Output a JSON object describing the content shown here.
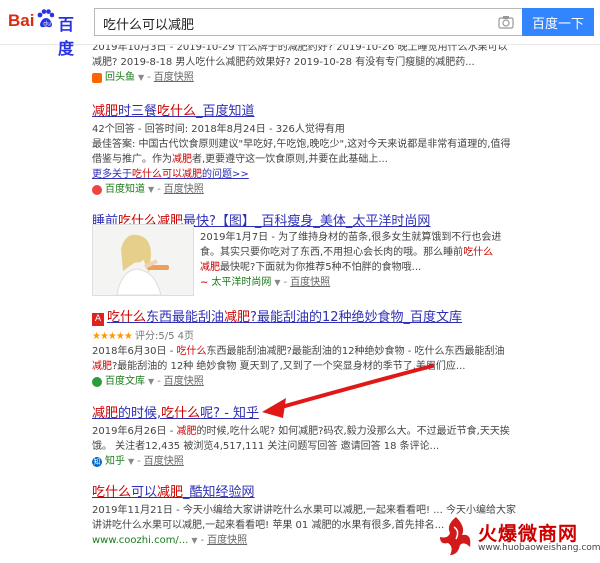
{
  "header": {
    "logo_bai": "Bai",
    "logo_du": "百度",
    "query": "吃什么可以减肥",
    "search_button": "百度一下",
    "camera_icon": "camera-icon"
  },
  "r0": {
    "line1": "2019年10月3日 - 2019-10-29 什么牌子的减肥药好? 2019-10-26 晚上睡觉用什么水果可以",
    "line2": "减肥? 2019-8-18 男人吃什么减肥药效果好? 2019-10-28 有没有专门瘦腿的减肥药...",
    "source": "回头鱼",
    "kuaizhao": "百度快照"
  },
  "r1": {
    "title_a": "减肥",
    "title_b": "时三餐",
    "title_c": "吃什么",
    "title_d": "_百度知道",
    "meta": "42个回答 - 回答时间: 2018年8月24日 - 326人觉得有用",
    "ans_pre": "最佳答案: 中国古代饮食原则建议\"早吃好,午吃饱,晚吃少\",这对今天来说都是非常有道理的,值得",
    "ans2_pre": "借鉴与推广。作为",
    "ans2_em": "减肥",
    "ans2_post": "者,更要遵守这一饮食原则,并要在此基础上...",
    "more_pre": "更多关于",
    "more_em": "吃什么可以减肥",
    "more_post": "的问题>>",
    "source": "百度知道",
    "kuaizhao": "百度快照"
  },
  "r2": {
    "title_a": "睡前",
    "title_b": "吃什么减肥",
    "title_c": "最快?【图】_百科瘦身_美体_太平洋时尚网",
    "l1": "2019年1月7日 - 为了维持身材的苗条,很多女生就算饿到不行也会进",
    "l2": "食。其实只要你吃对了东西,不用担心会长肉的哦。那么睡前",
    "l2_em": "吃什么",
    "l3_em": "减肥",
    "l3": "最快呢?下面就为你推荐5种不怕胖的食物哦...",
    "source": "太平洋时尚网",
    "kuaizhao": "百度快照"
  },
  "r3": {
    "title_a": "吃什么",
    "title_b": "东西最能刮油",
    "title_c": "减肥",
    "title_d": "?最能刮油的12种绝妙食物_百度文库",
    "stars": "★★★★★",
    "rating": "评分:5/5 4页",
    "l1_pre": "2018年6月30日 - ",
    "l1_em": "吃什么",
    "l1_post": "东西最能刮油减肥?最能刮油的12种绝妙食物 - 吃什么东西最能刮油",
    "l2_em": "减肥",
    "l2_post": "?最能刮油的 12种 绝妙食物 夏天到了,又到了一个突显身材的季节了,美眉们应...",
    "source": "百度文库",
    "kuaizhao": "百度快照"
  },
  "r4": {
    "title_a": "减肥",
    "title_b": "的时候,",
    "title_c": "吃什么",
    "title_d": "呢? - 知乎",
    "l1_pre": "2019年6月26日 - ",
    "l1_em": "减肥",
    "l1_post": "的时候,吃什么呢? 如何减肥?码农,毅力没那么大。不过最近节食,天天挨",
    "l2": "饿。 关注者12,435 被浏览4,517,111 关注问题写回答 邀请回答 18 条评论...",
    "source": "知乎",
    "kuaizhao": "百度快照"
  },
  "r5": {
    "title_a": "吃什么",
    "title_b": "可以",
    "title_c": "减肥",
    "title_d": "_酷知经验网",
    "l1": "2019年11月21日 - 今天小编给大家讲讲吃什么水果可以减肥,一起来看看吧! ... 今天小编给大家",
    "l2": "讲讲吃什么水果可以减肥,一起来看看吧! 苹果 01 减肥的水果有很多,首先排名...",
    "source": "www.coozhi.com/...",
    "kuaizhao": "百度快照"
  },
  "watermark": {
    "name": "火爆微商网",
    "url": "www.huobaoweishang.com"
  }
}
